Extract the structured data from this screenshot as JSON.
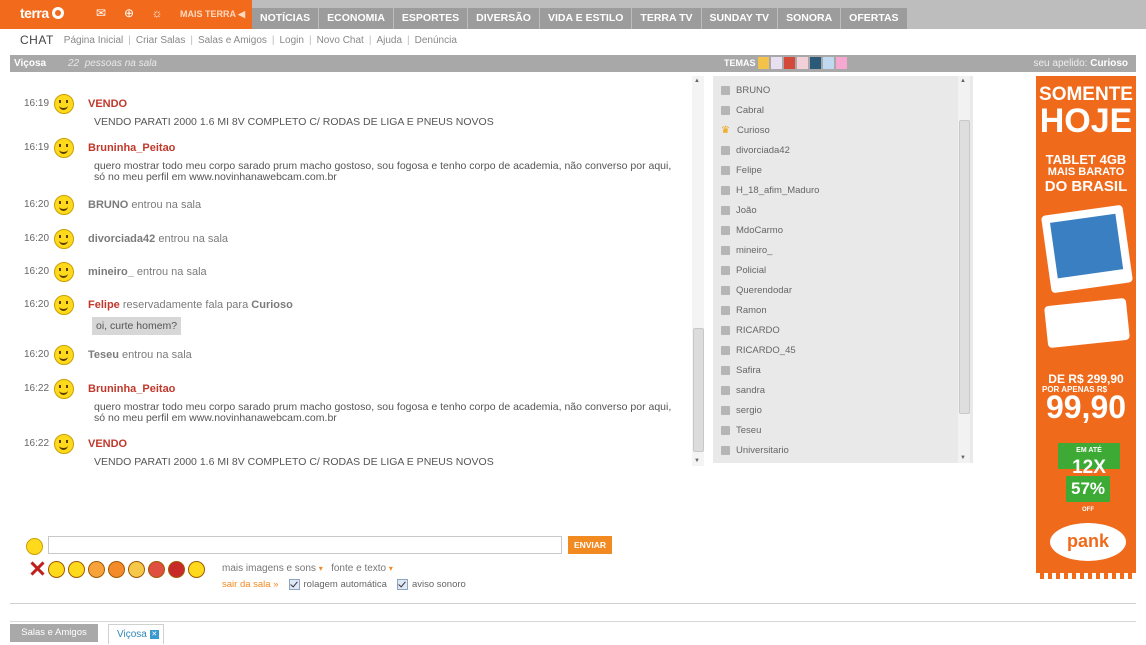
{
  "header": {
    "logo": "terra",
    "mais": "MAIS TERRA ◀",
    "nav": [
      "NOTÍCIAS",
      "ECONOMIA",
      "ESPORTES",
      "DIVERSÃO",
      "VIDA E ESTILO",
      "TERRA TV",
      "SUNDAY TV",
      "SONORA",
      "OFERTAS"
    ]
  },
  "subnav": {
    "brand": "CHAT",
    "links": [
      "Página Inicial",
      "Criar Salas",
      "Salas e Amigos",
      "Login",
      "Novo Chat",
      "Ajuda",
      "Denúncia"
    ]
  },
  "room": {
    "name": "Viçosa",
    "count": "22",
    "count_label": "pessoas na sala",
    "temas": "TEMAS",
    "apelido_label": "seu apelido:",
    "apelido": "Curioso"
  },
  "messages": [
    {
      "time": "16:19",
      "nick": "VENDO",
      "text": "VENDO PARATI 2000 1.6 MI 8V COMPLETO C/ RODAS DE LIGA E PNEUS NOVOS"
    },
    {
      "time": "16:19",
      "nick": "Bruninha_Peitao",
      "text1": "quero mostrar todo meu corpo sarado prum macho gostoso, sou fogosa e tenho corpo de academia, não converso por aqui,",
      "text2": "só no meu perfil em www.novinhanawebcam.com.br"
    },
    {
      "time": "16:20",
      "nick": "BRUNO",
      "action": "entrou na sala"
    },
    {
      "time": "16:20",
      "nick": "divorciada42",
      "action": "entrou na sala"
    },
    {
      "time": "16:20",
      "nick": "mineiro_",
      "action": "entrou na sala"
    },
    {
      "time": "16:20",
      "nick": "Felipe",
      "action": "reservadamente fala para",
      "target": "Curioso",
      "text": "oi, curte homem?"
    },
    {
      "time": "16:20",
      "nick": "Teseu",
      "action": "entrou na sala"
    },
    {
      "time": "16:22",
      "nick": "Bruninha_Peitao",
      "text1": "quero mostrar todo meu corpo sarado prum macho gostoso, sou fogosa e tenho corpo de academia, não converso por aqui,",
      "text2": "só no meu perfil em www.novinhanawebcam.com.br"
    },
    {
      "time": "16:22",
      "nick": "VENDO",
      "text": "VENDO PARATI 2000 1.6 MI 8V COMPLETO C/ RODAS DE LIGA E PNEUS NOVOS"
    }
  ],
  "users": [
    "BRUNO",
    "Cabral",
    "Curioso",
    "divorciada42",
    "Felipe",
    "H_18_afim_Maduro",
    "João",
    "MdoCarmo",
    "mineiro_",
    "Policial",
    "Querendodar",
    "Ramon",
    "RICARDO",
    "RICARDO_45",
    "Safira",
    "sandra",
    "sergio",
    "Teseu",
    "Universitario"
  ],
  "ad": {
    "l1": "SOMENTE",
    "l2": "HOJE",
    "l3": "TABLET 4GB",
    "l4": "MAIS BARATO",
    "l5": "DO BRASIL",
    "p1": "DE R$ 299,90",
    "p2": "POR APENAS R$",
    "p3": "99,90",
    "em": "EM ATÉ",
    "x": "12X",
    "pct": "57%",
    "off": "OFF",
    "brand": "pank"
  },
  "compose": {
    "send": "ENVIAR",
    "more": "mais imagens e sons",
    "font": "fonte e texto",
    "leave": "sair da sala »",
    "autoscroll": "rolagem automática",
    "sound": "aviso sonoro"
  },
  "tabs": {
    "friends": "Salas e Amigos",
    "room": "Viçosa"
  },
  "colors": {
    "accent": "#f26b1d",
    "nick": "#c0382b",
    "link": "#2f86b5"
  }
}
